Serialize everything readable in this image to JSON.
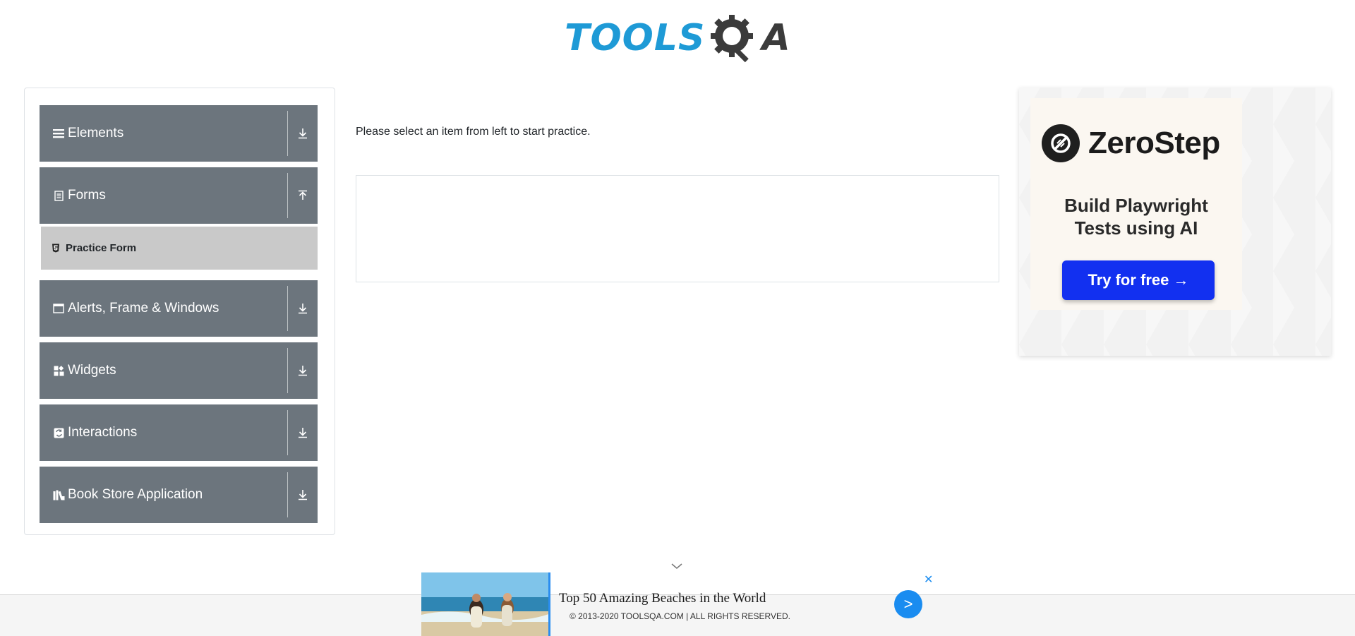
{
  "header": {
    "logo_left": "TOOLS",
    "logo_right": "A"
  },
  "sidebar": {
    "groups": [
      {
        "label": "Elements",
        "icon": "hamburger-icon",
        "arrow": "download-icon"
      },
      {
        "label": "Forms",
        "icon": "document-icon",
        "arrow": "upload-icon"
      },
      {
        "label": "Alerts, Frame & Windows",
        "icon": "window-icon",
        "arrow": "download-icon"
      },
      {
        "label": "Widgets",
        "icon": "widgets-icon",
        "arrow": "download-icon"
      },
      {
        "label": "Interactions",
        "icon": "interaction-icon",
        "arrow": "download-icon"
      },
      {
        "label": "Book Store Application",
        "icon": "books-icon",
        "arrow": "download-icon"
      }
    ],
    "sub_items": [
      {
        "label": "Practice Form",
        "icon": "html5-icon"
      }
    ]
  },
  "main": {
    "instruction": "Please select an item from left to start practice."
  },
  "ad": {
    "brand": "ZeroStep",
    "headline_line1": "Build Playwright",
    "headline_line2": "Tests using AI",
    "cta": "Try for free →",
    "cta_color": "#1230f0"
  },
  "bottom_ad": {
    "title": "Top 50 Amazing Beaches in the World",
    "go_label": ">",
    "close_label": "✕"
  },
  "footer": {
    "text": "© 2013-2020 TOOLSQA.COM | ALL RIGHTS RESERVED."
  },
  "colors": {
    "sidebar_group_bg": "#6c757d",
    "sub_item_bg": "#c9c9c9",
    "logo_blue": "#1e9ad6",
    "logo_dark": "#3b3b3b"
  }
}
